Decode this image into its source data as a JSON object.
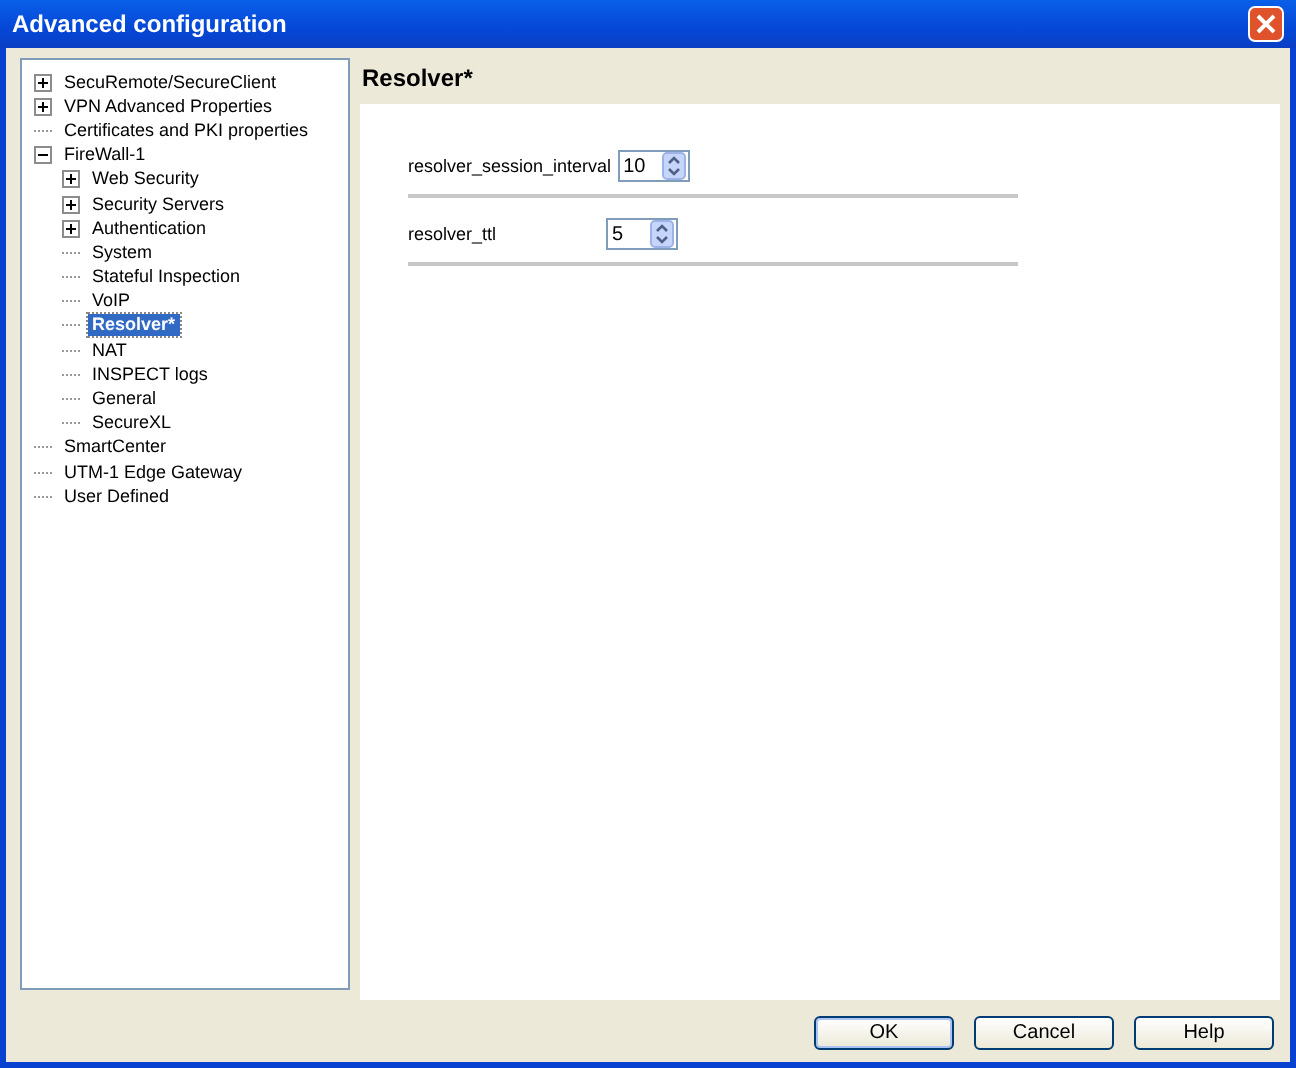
{
  "window": {
    "title": "Advanced configuration"
  },
  "tree": [
    {
      "label": "SecuRemote/SecureClient",
      "kind": "collapsed",
      "selected": false
    },
    {
      "label": "VPN Advanced Properties",
      "kind": "collapsed",
      "selected": false
    },
    {
      "label": "Certificates and PKI properties",
      "kind": "leaf",
      "selected": false
    },
    {
      "label": "FireWall-1",
      "kind": "expanded",
      "selected": false,
      "children": [
        {
          "label": "Web Security",
          "kind": "collapsed",
          "selected": false
        },
        {
          "label": "Security Servers",
          "kind": "collapsed",
          "selected": false
        },
        {
          "label": "Authentication",
          "kind": "collapsed",
          "selected": false
        },
        {
          "label": "System",
          "kind": "leaf",
          "selected": false
        },
        {
          "label": "Stateful Inspection",
          "kind": "leaf",
          "selected": false
        },
        {
          "label": "VoIP",
          "kind": "leaf",
          "selected": false
        },
        {
          "label": "Resolver*",
          "kind": "leaf",
          "selected": true
        },
        {
          "label": "NAT",
          "kind": "leaf",
          "selected": false
        },
        {
          "label": "INSPECT logs",
          "kind": "leaf",
          "selected": false
        },
        {
          "label": "General",
          "kind": "leaf",
          "selected": false
        },
        {
          "label": "SecureXL",
          "kind": "leaf",
          "selected": false
        }
      ]
    },
    {
      "label": "SmartCenter",
      "kind": "leaf",
      "selected": false
    },
    {
      "label": "UTM-1 Edge Gateway",
      "kind": "leaf",
      "selected": false
    },
    {
      "label": "User Defined",
      "kind": "leaf",
      "selected": false
    }
  ],
  "panel": {
    "title": "Resolver*",
    "fields": [
      {
        "label": "resolver_session_interval",
        "value": "10"
      },
      {
        "label": "resolver_ttl",
        "value": "5"
      }
    ]
  },
  "buttons": [
    "OK",
    "Cancel",
    "Help"
  ]
}
